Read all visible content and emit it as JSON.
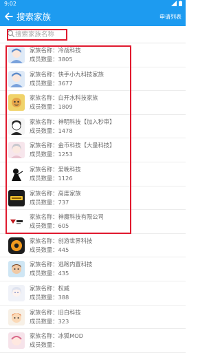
{
  "status_bar": {
    "time": "9:02"
  },
  "app_bar": {
    "title": "搜索家族",
    "action": "申请列表"
  },
  "search": {
    "placeholder": "搜索家族名称",
    "value": ""
  },
  "labels": {
    "name_prefix": "家族名称：",
    "count_prefix": "成员数量："
  },
  "colors": {
    "primary": "#1d9bf0",
    "highlight": "#e0192e",
    "text": "#6d6d6d"
  },
  "families": [
    {
      "name": "冷战科技",
      "count": "3805",
      "avatar": "anime-avatar-blue"
    },
    {
      "name": "快手小九科技家族",
      "count": "3677",
      "avatar": "anime-avatar-blue"
    },
    {
      "name": "白开水科技家族",
      "count": "1809",
      "avatar": "cartoon-avatar-yellow"
    },
    {
      "name": "神明科技【加入秒审】",
      "count": "1478",
      "avatar": "anime-avatar-black-white"
    },
    {
      "name": "金币科技【大量科技】",
      "count": "1253",
      "avatar": "anime-avatar-pink"
    },
    {
      "name": "爱晚科技",
      "count": "1126",
      "avatar": "silhouette-avatar"
    },
    {
      "name": "高度家族",
      "count": "737",
      "avatar": "gold-badge-avatar"
    },
    {
      "name": "神魔科技有限公司",
      "count": "605",
      "avatar": "logo-avatar"
    },
    {
      "name": "创游世界科技",
      "count": "445",
      "avatar": "orange-eye-avatar"
    },
    {
      "name": "逃跑内置科技",
      "count": "435",
      "avatar": "cartoon-avatar-brown"
    },
    {
      "name": "权威",
      "count": "388",
      "avatar": "anime-avatar-white"
    },
    {
      "name": "旧白科技",
      "count": "323",
      "avatar": "cartoon-avatar-orange"
    },
    {
      "name": "冰狐MOD",
      "count": "",
      "avatar": "cartoon-avatar-pink"
    }
  ]
}
